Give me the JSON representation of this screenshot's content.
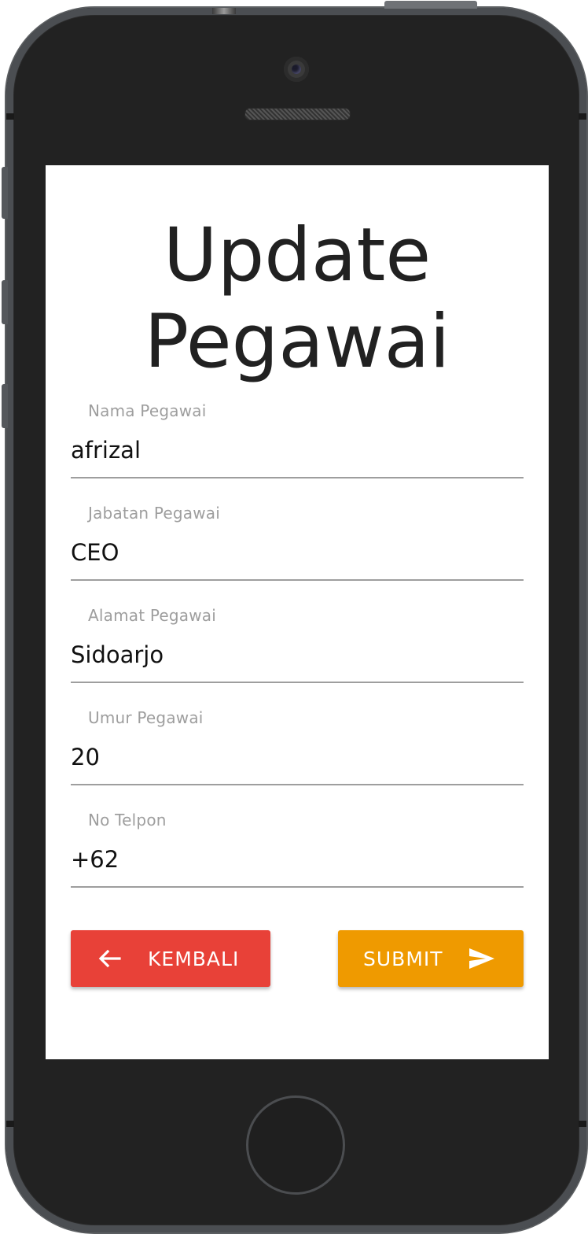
{
  "screen": {
    "title_line1": "Update",
    "title_line2": "Pegawai"
  },
  "form": {
    "fields": [
      {
        "label": "Nama Pegawai",
        "value": "afrizal"
      },
      {
        "label": "Jabatan Pegawai",
        "value": "CEO"
      },
      {
        "label": "Alamat Pegawai",
        "value": "Sidoarjo"
      },
      {
        "label": "Umur Pegawai",
        "value": "20"
      },
      {
        "label": "No Telpon",
        "value": "+62"
      }
    ]
  },
  "buttons": {
    "back_label": "KEMBALI",
    "back_icon": "arrow-left-icon",
    "back_color": "#e84138",
    "submit_label": "SUBMIT",
    "submit_icon": "send-icon",
    "submit_color": "#ef9a00"
  }
}
